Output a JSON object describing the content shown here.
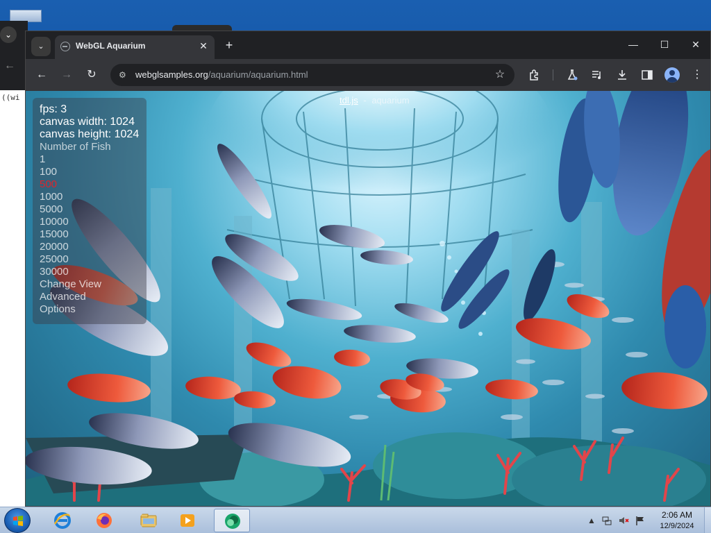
{
  "background_window": {
    "code_snippet": "((wi"
  },
  "browser": {
    "tab": {
      "title": "WebGL Aquarium",
      "close_label": "✕"
    },
    "new_tab_label": "+",
    "window_controls": {
      "minimize": "—",
      "maximize": "☐",
      "close": "✕"
    },
    "toolbar": {
      "back": "←",
      "forward": "→",
      "reload": "↻",
      "url_host": "webglsamples.org",
      "url_path": "/aquarium/aquarium.html",
      "bookmark": "☆"
    }
  },
  "page": {
    "header": {
      "link": "tdl.js",
      "separator": "-",
      "title": "aquarium"
    },
    "stats": {
      "fps": "fps: 3",
      "canvas_width": "canvas width: 1024",
      "canvas_height": "canvas height: 1024"
    },
    "menu": {
      "fish_header": "Number of Fish",
      "fish_options": [
        "1",
        "100",
        "500",
        "1000",
        "5000",
        "10000",
        "15000",
        "20000",
        "25000",
        "30000"
      ],
      "selected_fish": "500",
      "change_view": "Change View",
      "advanced": "Advanced",
      "options": "Options"
    }
  },
  "taskbar": {
    "apps": [
      "Internet Explorer",
      "Firefox",
      "Windows Explorer",
      "Media Player",
      "Active App"
    ],
    "tray": {
      "show_hidden": "▲",
      "time": "2:06 AM",
      "date": "12/9/2024"
    }
  },
  "colors": {
    "selected_menu": "#e0242b",
    "water": "#4fb0cf",
    "taskbar": "#c9d8ea"
  }
}
